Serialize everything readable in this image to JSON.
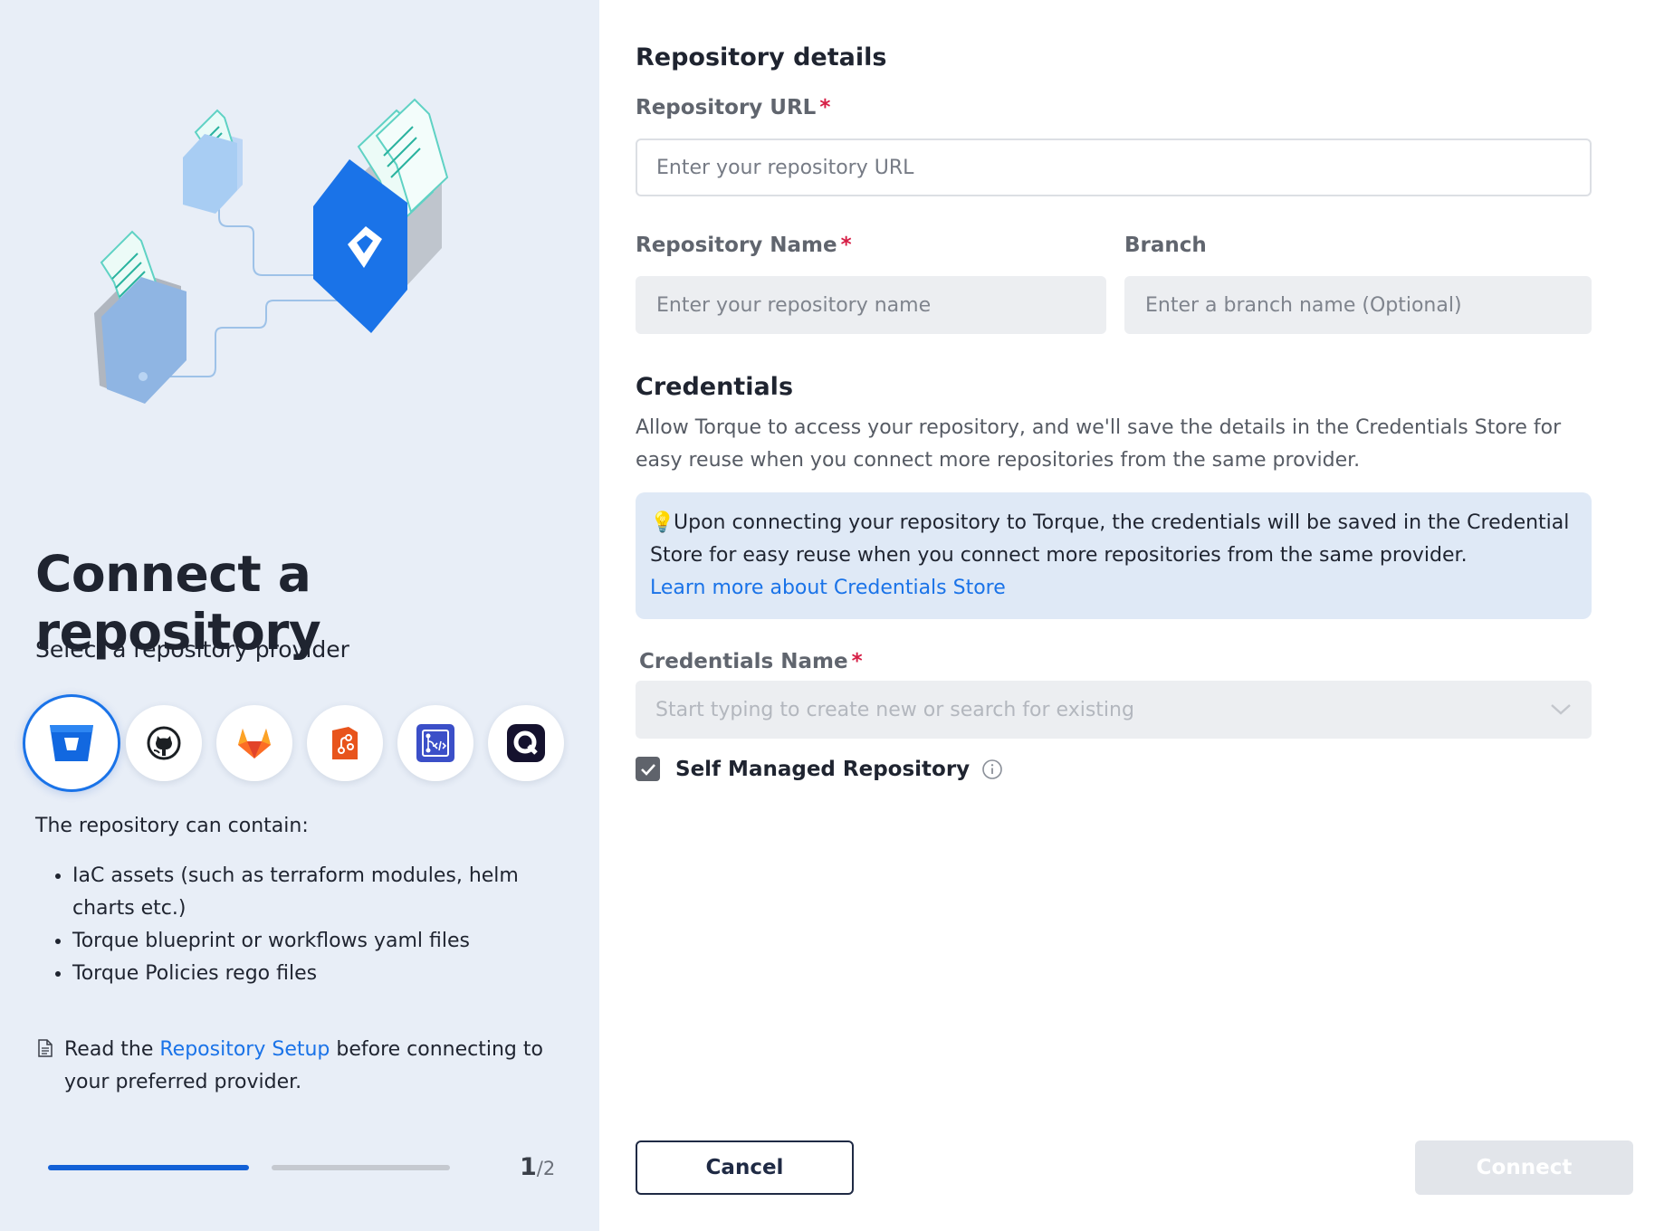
{
  "left": {
    "title": "Connect a repository",
    "subtitle": "Select a repository provider",
    "providers": [
      {
        "name": "Bitbucket",
        "icon": "bitbucket-icon",
        "selected": true
      },
      {
        "name": "GitHub",
        "icon": "github-icon",
        "selected": false
      },
      {
        "name": "GitLab",
        "icon": "gitlab-icon",
        "selected": false
      },
      {
        "name": "AWS CodeCommit",
        "icon": "codecommit-icon",
        "selected": false
      },
      {
        "name": "Azure Repos",
        "icon": "azure-repos-icon",
        "selected": false
      },
      {
        "name": "Quali",
        "icon": "quali-icon",
        "selected": false
      }
    ],
    "contain_text": "The repository can contain:",
    "bullets": [
      "IaC assets (such as terraform modules, helm charts etc.)",
      "Torque blueprint or workflows yaml files",
      "Torque Policies rego files"
    ],
    "read_prefix": "Read the ",
    "read_link": "Repository Setup",
    "read_suffix": " before connecting to your preferred provider.",
    "step_current": "1",
    "step_total": "/2",
    "progress_fraction": 0.5
  },
  "form": {
    "details_heading": "Repository details",
    "url_label": "Repository URL",
    "url_placeholder": "Enter your repository URL",
    "url_value": "",
    "name_label": "Repository Name",
    "name_placeholder": "Enter your repository name",
    "name_value": "",
    "branch_label": "Branch",
    "branch_placeholder": "Enter a branch name (Optional)",
    "branch_value": "",
    "required_mark": "*"
  },
  "credentials": {
    "heading": "Credentials",
    "description": "Allow Torque to access your repository, and we'll save the details in the Credentials Store for easy reuse when you connect more repositories from the same provider.",
    "info_emoji": "💡",
    "info_text": "Upon connecting your repository to Torque, the credentials will be saved in the Credential Store for easy reuse when you connect more repositories from the same provider.",
    "info_link": "Learn more about Credentials Store",
    "name_label": "Credentials Name",
    "name_placeholder": "Start typing to create new or search for existing",
    "self_managed_label": "Self Managed Repository",
    "self_managed_checked": true
  },
  "actions": {
    "cancel": "Cancel",
    "connect": "Connect"
  },
  "colors": {
    "accent": "#1a73e8",
    "left_panel_bg": "#e8eef7",
    "required": "#d61e45",
    "info_box_bg": "#dfe9f6",
    "disabled_button": "#e2e5ea"
  }
}
